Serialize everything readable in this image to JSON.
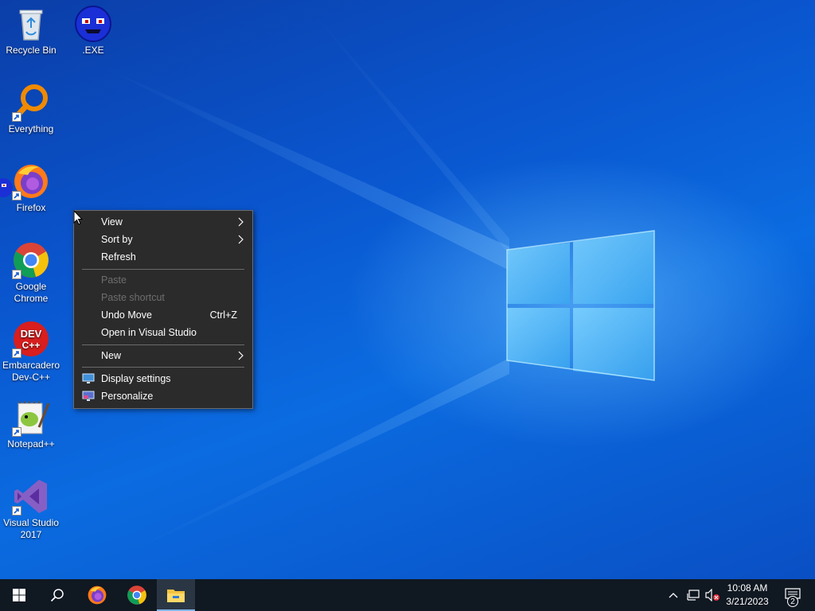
{
  "desktop": {
    "icons": [
      {
        "label": "Recycle Bin"
      },
      {
        "label": ".EXE"
      },
      {
        "label": "Everything"
      },
      {
        "label": "Firefox"
      },
      {
        "label": "Google Chrome"
      },
      {
        "label": "Embarcadero Dev-C++"
      },
      {
        "label": "Notepad++"
      },
      {
        "label": "Visual Studio 2017"
      }
    ]
  },
  "context_menu": {
    "view": "View",
    "sort_by": "Sort by",
    "refresh": "Refresh",
    "paste": "Paste",
    "paste_shortcut": "Paste shortcut",
    "undo_move": "Undo Move",
    "undo_move_shortcut": "Ctrl+Z",
    "open_in_visual_studio": "Open in Visual Studio",
    "new": "New",
    "display_settings": "Display settings",
    "personalize": "Personalize"
  },
  "taskbar": {
    "clock_time": "10:08 AM",
    "clock_date": "3/21/2023",
    "notification_count": "2"
  },
  "colors": {
    "menu_bg": "#2b2b2b",
    "taskbar_bg": "#101822",
    "desktop_blue": "#0a56cf"
  }
}
